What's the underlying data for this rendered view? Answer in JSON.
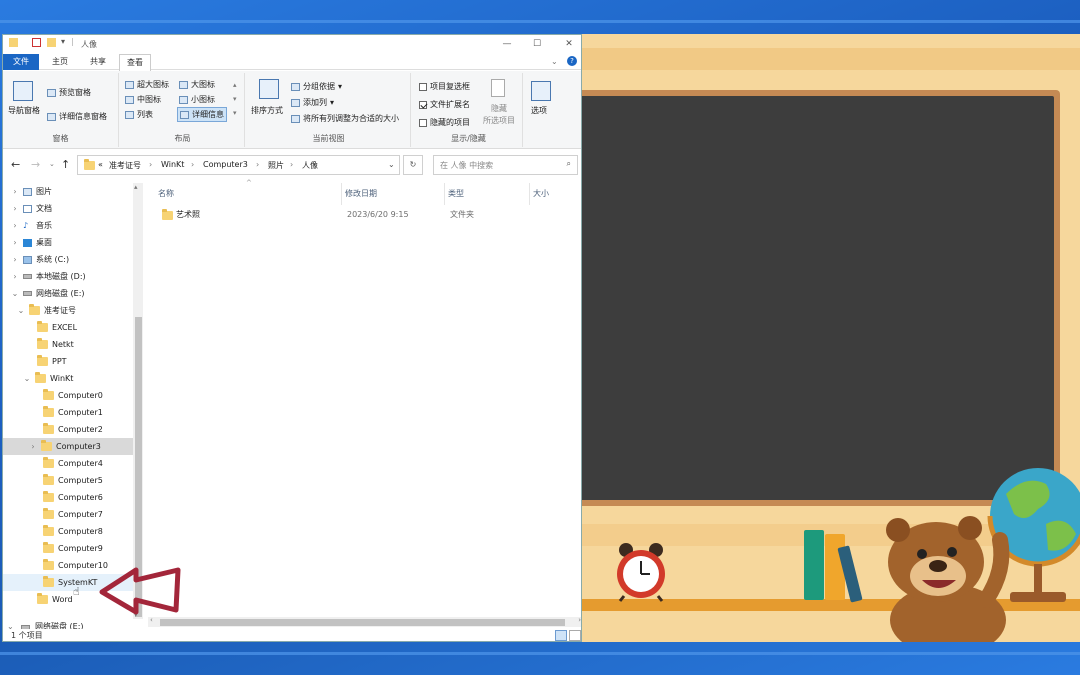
{
  "window": {
    "title": "人像",
    "tabs": {
      "file": "文件",
      "home": "主页",
      "share": "共享",
      "view": "查看"
    },
    "controls": {
      "minimize": "—",
      "maximize": "☐",
      "close": "✕"
    }
  },
  "ribbon": {
    "pane_group": {
      "nav_pane": "导航窗格",
      "preview_pane": "预览窗格",
      "details_pane": "详细信息窗格",
      "label": "窗格"
    },
    "layout_group": {
      "xl_icons": "超大图标",
      "large_icons": "大图标",
      "medium_icons": "中图标",
      "small_icons": "小图标",
      "list": "列表",
      "details": "详细信息",
      "label": "布局"
    },
    "view_group": {
      "sort": "排序方式",
      "group_by": "分组依据",
      "add_column": "添加列",
      "fit_columns": "将所有列调整为合适的大小",
      "label": "当前视图"
    },
    "show_group": {
      "item_checkboxes": "项目复选框",
      "file_ext": "文件扩展名",
      "hidden_items": "隐藏的项目",
      "hide_selected": "隐藏",
      "hide_selected_sub": "所选项目",
      "label": "显示/隐藏"
    },
    "options": "选项"
  },
  "address": {
    "prefix": "«",
    "crumbs": [
      "准考证号",
      "WinKt",
      "Computer3",
      "照片",
      "人像"
    ],
    "search_placeholder": "在 人像 中搜索"
  },
  "nav": {
    "items": [
      {
        "label": "图片"
      },
      {
        "label": "文档"
      },
      {
        "label": "音乐"
      },
      {
        "label": "桌面"
      },
      {
        "label": "系统 (C:)"
      },
      {
        "label": "本地磁盘 (D:)"
      },
      {
        "label": "网络磁盘 (E:)"
      },
      {
        "label": "准考证号"
      },
      {
        "label": "EXCEL"
      },
      {
        "label": "Netkt"
      },
      {
        "label": "PPT"
      },
      {
        "label": "WinKt"
      },
      {
        "label": "Computer0"
      },
      {
        "label": "Computer1"
      },
      {
        "label": "Computer2"
      },
      {
        "label": "Computer3"
      },
      {
        "label": "Computer4"
      },
      {
        "label": "Computer5"
      },
      {
        "label": "Computer6"
      },
      {
        "label": "Computer7"
      },
      {
        "label": "Computer8"
      },
      {
        "label": "Computer9"
      },
      {
        "label": "Computer10"
      },
      {
        "label": "SystemKT"
      },
      {
        "label": "Word"
      }
    ],
    "bottom_drive": "网络磁盘 (E:)"
  },
  "columns": {
    "name": "名称",
    "modified": "修改日期",
    "type": "类型",
    "size": "大小"
  },
  "files": [
    {
      "name": "艺术照",
      "modified": "2023/6/20 9:15",
      "type": "文件夹",
      "size": ""
    }
  ],
  "status": {
    "count": "1 个项目"
  },
  "colors": {
    "accent": "#1a66c4",
    "folder": "#f7d374",
    "arrow": "#a3263a",
    "board": "#3d3d3d"
  }
}
